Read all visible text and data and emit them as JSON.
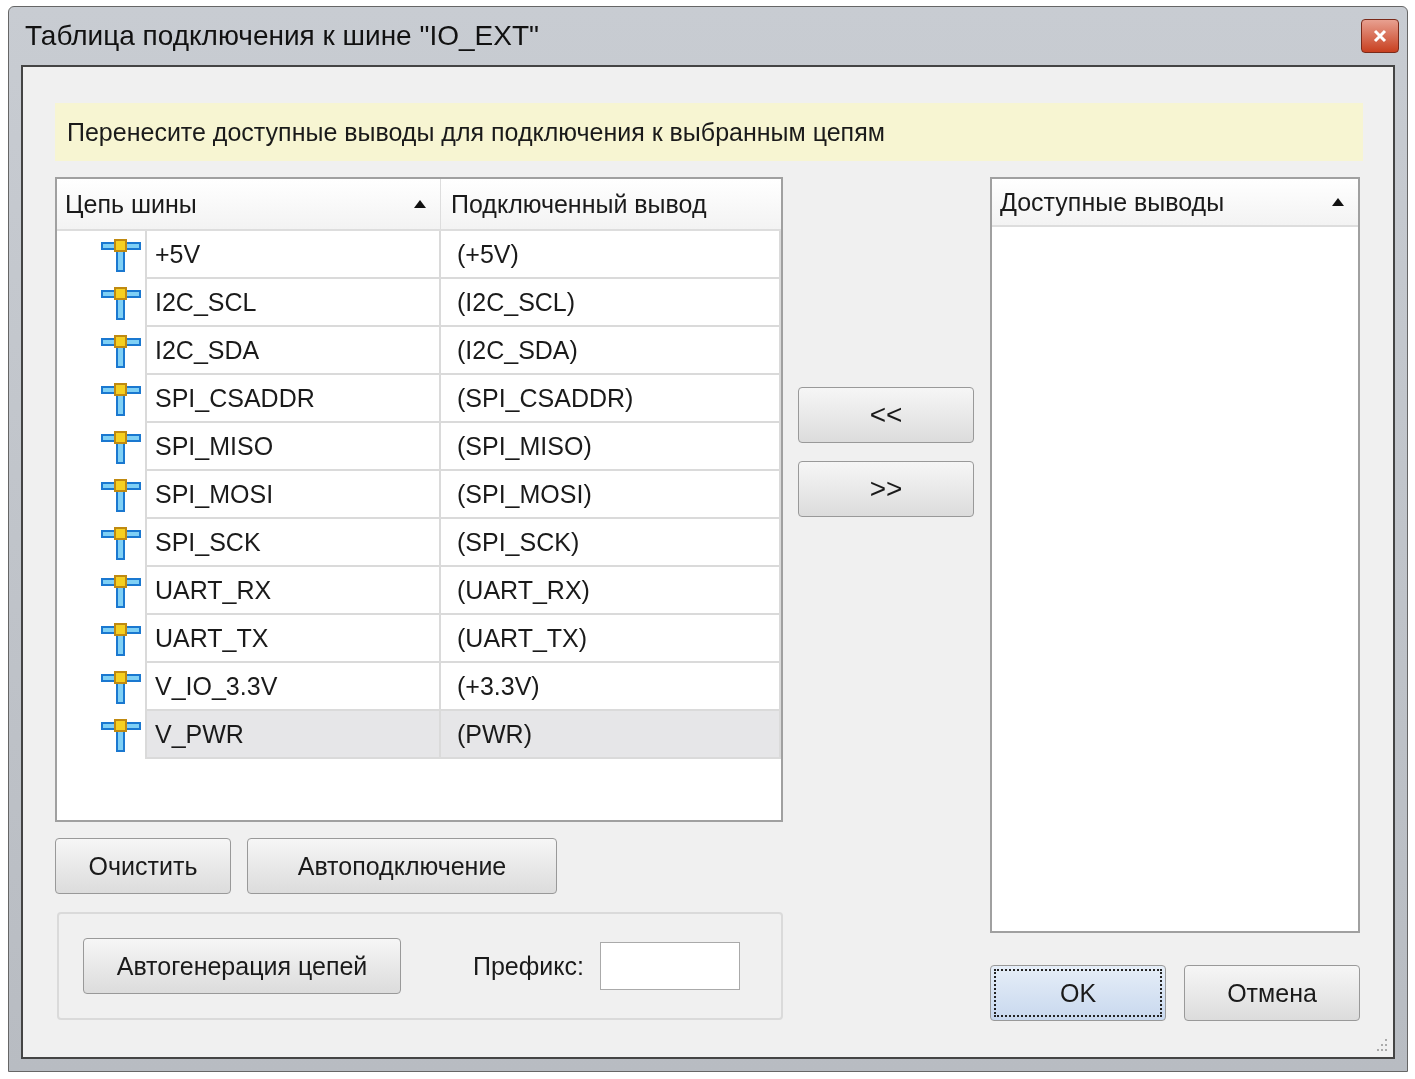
{
  "window": {
    "title": "Таблица подключения к шине \"IO_EXT\""
  },
  "hint": "Перенесите доступные выводы для подключения к выбранным цепям",
  "nets_table": {
    "columns": [
      {
        "label": "Цепь шины",
        "sorted": true
      },
      {
        "label": "Подключенный вывод",
        "sorted": false
      }
    ],
    "rows": [
      {
        "net": "+5V",
        "pin": "(+5V)",
        "selected": false
      },
      {
        "net": "I2C_SCL",
        "pin": "(I2C_SCL)",
        "selected": false
      },
      {
        "net": "I2C_SDA",
        "pin": "(I2C_SDA)",
        "selected": false
      },
      {
        "net": "SPI_CSADDR",
        "pin": "(SPI_CSADDR)",
        "selected": false
      },
      {
        "net": "SPI_MISO",
        "pin": "(SPI_MISO)",
        "selected": false
      },
      {
        "net": "SPI_MOSI",
        "pin": "(SPI_MOSI)",
        "selected": false
      },
      {
        "net": "SPI_SCK",
        "pin": "(SPI_SCK)",
        "selected": false
      },
      {
        "net": "UART_RX",
        "pin": "(UART_RX)",
        "selected": false
      },
      {
        "net": "UART_TX",
        "pin": "(UART_TX)",
        "selected": false
      },
      {
        "net": "V_IO_3.3V",
        "pin": "(+3.3V)",
        "selected": false
      },
      {
        "net": "V_PWR",
        "pin": "(PWR)",
        "selected": true
      }
    ]
  },
  "transfer_buttons": [
    "<<",
    ">>"
  ],
  "available_list": {
    "columns": [
      {
        "label": "Доступные выводы",
        "sorted": true
      }
    ]
  },
  "table_buttons": [
    "Очистить",
    "Автоподключение"
  ],
  "autogen": {
    "button": "Автогенерация цепей",
    "prefix_label": "Префикс:"
  },
  "dialog_buttons": [
    {
      "label": "OK",
      "focused": true
    },
    {
      "label": "Отмена",
      "focused": false
    }
  ]
}
